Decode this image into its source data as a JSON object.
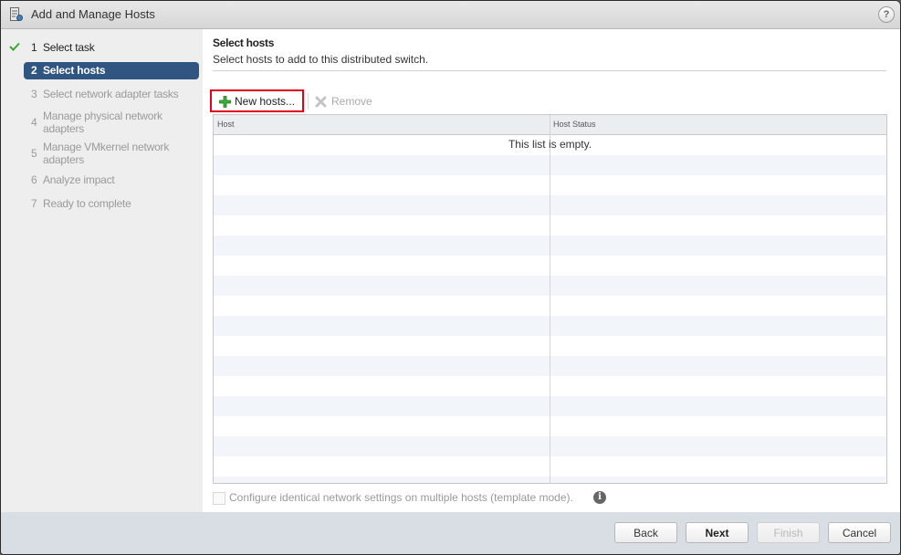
{
  "window": {
    "title": "Add and Manage Hosts",
    "title_icon": "host-wizard-icon",
    "help_icon_label": "?"
  },
  "steps": [
    {
      "number": "1",
      "label": "Select task",
      "state": "completed"
    },
    {
      "number": "2",
      "label": "Select hosts",
      "state": "active"
    },
    {
      "number": "3",
      "label": "Select network adapter tasks",
      "state": "pending"
    },
    {
      "number": "4",
      "label": "Manage physical network adapters",
      "state": "pending"
    },
    {
      "number": "5",
      "label": "Manage VMkernel network adapters",
      "state": "pending"
    },
    {
      "number": "6",
      "label": "Analyze impact",
      "state": "pending"
    },
    {
      "number": "7",
      "label": "Ready to complete",
      "state": "pending"
    }
  ],
  "page": {
    "heading": "Select hosts",
    "description": "Select hosts to add to this distributed switch."
  },
  "toolbar": {
    "new_hosts_label": "New hosts...",
    "remove_label": "Remove"
  },
  "grid": {
    "columns": [
      "Host",
      "Host Status"
    ],
    "rows": [],
    "empty_message": "This list is empty."
  },
  "template_mode": {
    "label": "Configure identical network settings on multiple hosts (template mode).",
    "checked": false,
    "enabled": false,
    "info_icon_label": "i"
  },
  "footer": {
    "back_label": "Back",
    "next_label": "Next",
    "finish_label": "Finish",
    "cancel_label": "Cancel"
  },
  "colors": {
    "active_step": "#2f5580",
    "highlight_border": "#e3001b",
    "completed_check": "#3aa832"
  }
}
